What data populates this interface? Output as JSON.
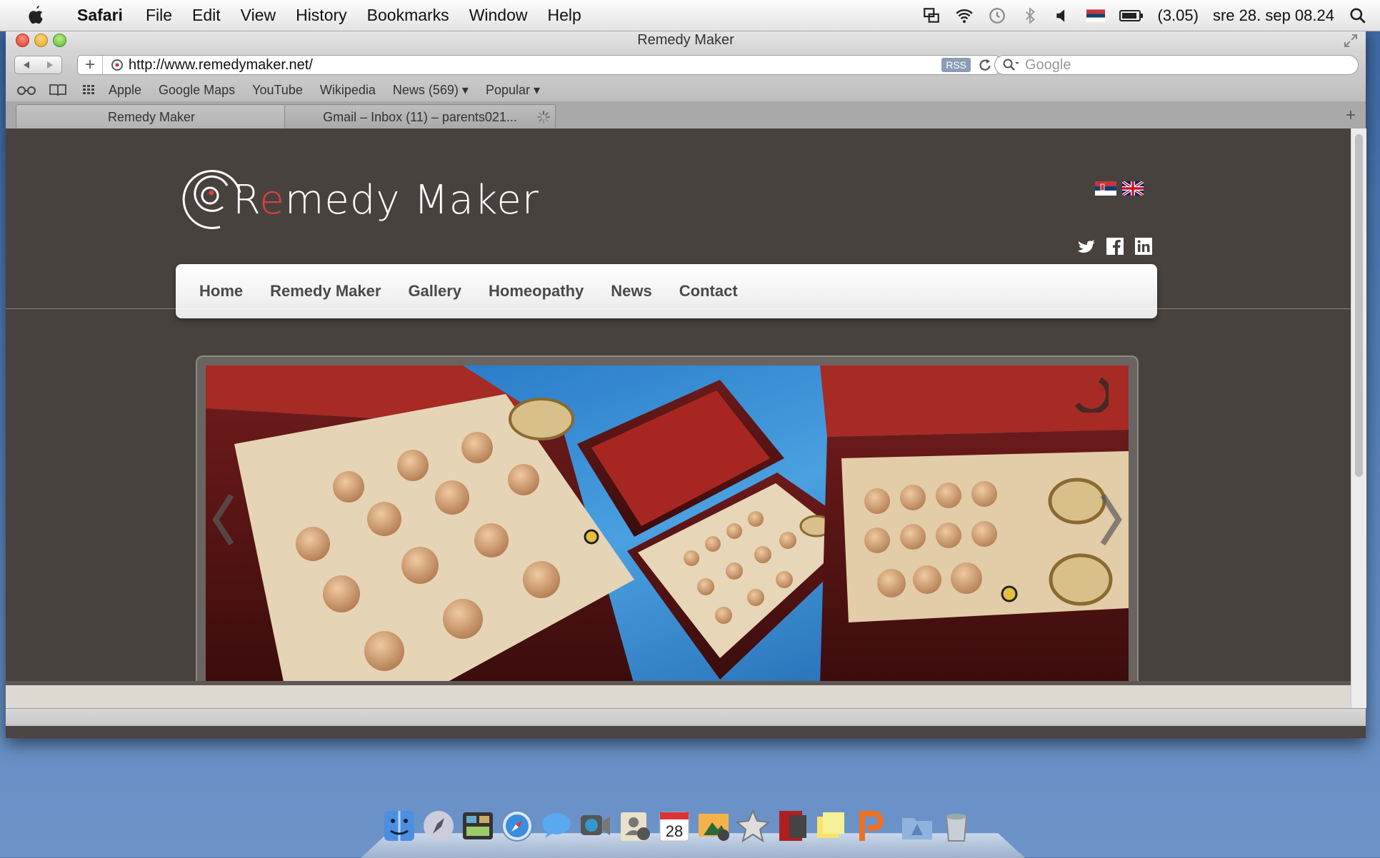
{
  "menubar": {
    "app": "Safari",
    "menus": [
      "File",
      "Edit",
      "View",
      "History",
      "Bookmarks",
      "Window",
      "Help"
    ],
    "battery": "(3.05)",
    "clock": "sre 28. sep  08.24"
  },
  "window": {
    "title": "Remedy Maker"
  },
  "toolbar": {
    "url": "http://www.remedymaker.net/",
    "rss": "RSS",
    "search_placeholder": "Google"
  },
  "bookmarks": [
    "Apple",
    "Google Maps",
    "YouTube",
    "Wikipedia",
    "News (569) ▾",
    "Popular ▾"
  ],
  "tabs": [
    {
      "label": "Remedy Maker"
    },
    {
      "label": "Gmail – Inbox (11) – parents021..."
    }
  ],
  "site": {
    "logo_prefix": "R",
    "logo_red": "e",
    "logo_suffix": "medy Maker",
    "nav": [
      "Home",
      "Remedy Maker",
      "Gallery",
      "Homeopathy",
      "News",
      "Contact"
    ]
  },
  "dock": {
    "calendar_day": "28"
  },
  "colors": {
    "page_bg": "#48423f",
    "nav_text": "#4a4a4a",
    "logo_accent": "#e04040"
  }
}
